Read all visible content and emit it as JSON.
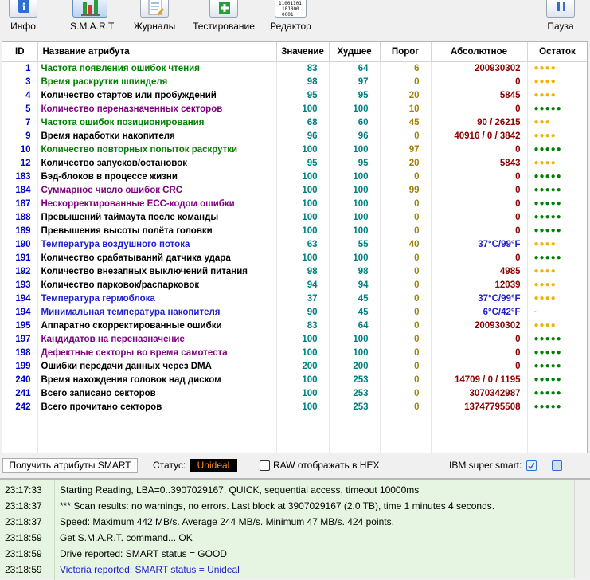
{
  "toolbar": {
    "buttons": [
      {
        "label": "Инфо"
      },
      {
        "label": "S.M.A.R.T"
      },
      {
        "label": "Журналы"
      },
      {
        "label": "Тестирование"
      },
      {
        "label": "Редактор"
      },
      {
        "label": "Пауза"
      }
    ],
    "editor_icon_text": "11001101\n101000\n0001"
  },
  "table": {
    "columns": [
      "ID",
      "Название атрибута",
      "Значение",
      "Худшее",
      "Порог",
      "Абсолютное",
      "Остаток"
    ],
    "rows": [
      {
        "id": "1",
        "name": "Частота появления ошибок чтения",
        "value": "83",
        "worst": "64",
        "thresh": "6",
        "raw": "200930302",
        "rem": "●●●●",
        "name_color": "#008000",
        "rem_color": "#f0b400"
      },
      {
        "id": "3",
        "name": "Время раскрутки шпинделя",
        "value": "98",
        "worst": "97",
        "thresh": "0",
        "raw": "0",
        "rem": "●●●●",
        "name_color": "#008000",
        "rem_color": "#f0b400"
      },
      {
        "id": "4",
        "name": "Количество стартов или пробуждений",
        "value": "95",
        "worst": "95",
        "thresh": "20",
        "raw": "5845",
        "rem": "●●●●",
        "name_color": "#000000",
        "rem_color": "#f0b400"
      },
      {
        "id": "5",
        "name": "Количество переназначенных секторов",
        "value": "100",
        "worst": "100",
        "thresh": "10",
        "raw": "0",
        "rem": "●●●●●",
        "name_color": "#800080",
        "rem_color": "#008000"
      },
      {
        "id": "7",
        "name": "Частота ошибок позиционирования",
        "value": "68",
        "worst": "60",
        "thresh": "45",
        "raw": "90 / 26215",
        "rem": "●●●",
        "name_color": "#008000",
        "rem_color": "#f0b400"
      },
      {
        "id": "9",
        "name": "Время наработки накопителя",
        "value": "96",
        "worst": "96",
        "thresh": "0",
        "raw": "40916 / 0 / 3842",
        "rem": "●●●●",
        "name_color": "#000000",
        "rem_color": "#f0b400"
      },
      {
        "id": "10",
        "name": "Количество повторных попыток раскрутки",
        "value": "100",
        "worst": "100",
        "thresh": "97",
        "raw": "0",
        "rem": "●●●●●",
        "name_color": "#008000",
        "rem_color": "#008000"
      },
      {
        "id": "12",
        "name": "Количество запусков/остановок",
        "value": "95",
        "worst": "95",
        "thresh": "20",
        "raw": "5843",
        "rem": "●●●●",
        "name_color": "#000000",
        "rem_color": "#f0b400"
      },
      {
        "id": "183",
        "name": "Бэд-блоков в процессе жизни",
        "value": "100",
        "worst": "100",
        "thresh": "0",
        "raw": "0",
        "rem": "●●●●●",
        "name_color": "#000000",
        "rem_color": "#008000"
      },
      {
        "id": "184",
        "name": "Суммарное число ошибок CRC",
        "value": "100",
        "worst": "100",
        "thresh": "99",
        "raw": "0",
        "rem": "●●●●●",
        "name_color": "#800080",
        "rem_color": "#008000"
      },
      {
        "id": "187",
        "name": "Нескорректированные ECC-кодом ошибки",
        "value": "100",
        "worst": "100",
        "thresh": "0",
        "raw": "0",
        "rem": "●●●●●",
        "name_color": "#800080",
        "rem_color": "#008000"
      },
      {
        "id": "188",
        "name": "Превышений таймаута после команды",
        "value": "100",
        "worst": "100",
        "thresh": "0",
        "raw": "0",
        "rem": "●●●●●",
        "name_color": "#000000",
        "rem_color": "#008000"
      },
      {
        "id": "189",
        "name": "Превышения высоты полёта головки",
        "value": "100",
        "worst": "100",
        "thresh": "0",
        "raw": "0",
        "rem": "●●●●●",
        "name_color": "#000000",
        "rem_color": "#008000"
      },
      {
        "id": "190",
        "name": "Температура воздушного потока",
        "value": "63",
        "worst": "55",
        "thresh": "40",
        "raw": "37°C/99°F",
        "rem": "●●●●",
        "name_color": "#1f1fcc",
        "rem_color": "#f0b400",
        "raw_color": "#1f1fcc"
      },
      {
        "id": "191",
        "name": "Количество срабатываний датчика удара",
        "value": "100",
        "worst": "100",
        "thresh": "0",
        "raw": "0",
        "rem": "●●●●●",
        "name_color": "#000000",
        "rem_color": "#008000"
      },
      {
        "id": "192",
        "name": "Количество внезапных выключений питания",
        "value": "98",
        "worst": "98",
        "thresh": "0",
        "raw": "4985",
        "rem": "●●●●",
        "name_color": "#000000",
        "rem_color": "#f0b400"
      },
      {
        "id": "193",
        "name": "Количество парковок/распарковок",
        "value": "94",
        "worst": "94",
        "thresh": "0",
        "raw": "12039",
        "rem": "●●●●",
        "name_color": "#000000",
        "rem_color": "#f0b400"
      },
      {
        "id": "194",
        "name": "Температура гермоблока",
        "value": "37",
        "worst": "45",
        "thresh": "0",
        "raw": "37°C/99°F",
        "rem": "●●●●",
        "name_color": "#1f1fcc",
        "rem_color": "#f0b400",
        "raw_color": "#1f1fcc"
      },
      {
        "id": "194",
        "name": "Минимальная температура накопителя",
        "value": "90",
        "worst": "45",
        "thresh": "0",
        "raw": "6°C/42°F",
        "rem": "-",
        "name_color": "#1f1fcc",
        "rem_color": "#1f1fcc",
        "raw_color": "#1f1fcc"
      },
      {
        "id": "195",
        "name": "Аппаратно скорректированные ошибки",
        "value": "83",
        "worst": "64",
        "thresh": "0",
        "raw": "200930302",
        "rem": "●●●●",
        "name_color": "#000000",
        "rem_color": "#f0b400"
      },
      {
        "id": "197",
        "name": "Кандидатов на переназначение",
        "value": "100",
        "worst": "100",
        "thresh": "0",
        "raw": "0",
        "rem": "●●●●●",
        "name_color": "#800080",
        "rem_color": "#008000"
      },
      {
        "id": "198",
        "name": "Дефектные секторы во время самотеста",
        "value": "100",
        "worst": "100",
        "thresh": "0",
        "raw": "0",
        "rem": "●●●●●",
        "name_color": "#800080",
        "rem_color": "#008000"
      },
      {
        "id": "199",
        "name": "Ошибки передачи данных через DMA",
        "value": "200",
        "worst": "200",
        "thresh": "0",
        "raw": "0",
        "rem": "●●●●●",
        "name_color": "#000000",
        "rem_color": "#008000"
      },
      {
        "id": "240",
        "name": "Время нахождения головок над диском",
        "value": "100",
        "worst": "253",
        "thresh": "0",
        "raw": "14709 / 0 / 1195",
        "rem": "●●●●●",
        "name_color": "#000000",
        "rem_color": "#008000"
      },
      {
        "id": "241",
        "name": "Всего записано секторов",
        "value": "100",
        "worst": "253",
        "thresh": "0",
        "raw": "3070342987",
        "rem": "●●●●●",
        "name_color": "#000000",
        "rem_color": "#008000"
      },
      {
        "id": "242",
        "name": "Всего прочитано секторов",
        "value": "100",
        "worst": "253",
        "thresh": "0",
        "raw": "13747795508",
        "rem": "●●●●●",
        "name_color": "#000000",
        "rem_color": "#008000"
      }
    ]
  },
  "statusbar": {
    "get_attrs_label": "Получить атрибуты SMART",
    "status_label": "Статус:",
    "status_value": "Unideal",
    "raw_hex_label": "RAW отображать в HEX",
    "ibm_label": "IBM super smart:"
  },
  "log": {
    "entries": [
      {
        "time": "23:17:33",
        "msg": "Starting Reading, LBA=0..3907029167, QUICK, sequential access, timeout 10000ms",
        "color": "#000000"
      },
      {
        "time": "23:18:37",
        "msg": "*** Scan results: no warnings, no errors. Last block at 3907029167 (2.0 TB), time 1 minutes 4 seconds.",
        "color": "#000000"
      },
      {
        "time": "23:18:37",
        "msg": "Speed: Maximum 442 MB/s. Average 244 MB/s. Minimum 47 MB/s. 424 points.",
        "color": "#000000"
      },
      {
        "time": "23:18:59",
        "msg": "Get S.M.A.R.T. command... OK",
        "color": "#000000"
      },
      {
        "time": "23:18:59",
        "msg": "Drive reported: SMART status = GOOD",
        "color": "#000000"
      },
      {
        "time": "23:18:59",
        "msg": "Victoria reported: SMART status = Unideal",
        "color": "#1f1fcc"
      }
    ]
  },
  "colors": {
    "id": "#0000cc",
    "value": "#008080",
    "worst": "#008080",
    "thresh": "#a08000",
    "raw": "#8b0000"
  }
}
